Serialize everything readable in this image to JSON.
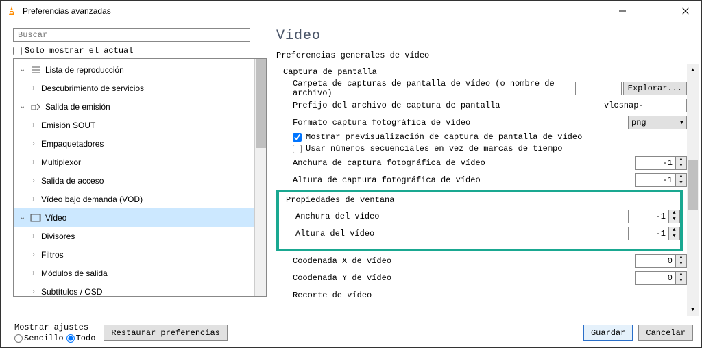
{
  "window": {
    "title": "Preferencias avanzadas"
  },
  "search": {
    "placeholder": "Buscar",
    "only_current_label": "Solo mostrar el actual"
  },
  "tree": {
    "items": [
      {
        "label": "Lista de reproducción",
        "level": 0,
        "expanded": true,
        "icon": "list"
      },
      {
        "label": "Descubrimiento de servicios",
        "level": 1
      },
      {
        "label": "Salida de emisión",
        "level": 0,
        "expanded": true,
        "icon": "stream"
      },
      {
        "label": "Emisión SOUT",
        "level": 1
      },
      {
        "label": "Empaquetadores",
        "level": 1
      },
      {
        "label": "Multiplexor",
        "level": 1
      },
      {
        "label": "Salida de acceso",
        "level": 1
      },
      {
        "label": "Vídeo bajo demanda (VOD)",
        "level": 1
      },
      {
        "label": "Vídeo",
        "level": 0,
        "expanded": true,
        "selected": true,
        "icon": "video"
      },
      {
        "label": "Divisores",
        "level": 1
      },
      {
        "label": "Filtros",
        "level": 1
      },
      {
        "label": "Módulos de salida",
        "level": 1
      },
      {
        "label": "Subtítulos / OSD",
        "level": 1
      }
    ]
  },
  "right": {
    "title": "Vídeo",
    "subtitle": "Preferencias generales de vídeo",
    "screenshot_group": "Captura de pantalla",
    "screenshot_folder_label": "Carpeta de capturas de pantalla de vídeo (o nombre de archivo)",
    "screenshot_folder_value": "",
    "browse_btn": "Explorar...",
    "prefix_label": "Prefijo del archivo de captura de pantalla",
    "prefix_value": "vlcsnap-",
    "format_label": "Formato captura fotográfica de vídeo",
    "format_value": "png",
    "show_preview_label": "Mostrar previsualización de captura de pantalla de vídeo",
    "use_seq_label": "Usar números secuenciales en vez de marcas de tiempo",
    "width_capture_label": "Anchura de captura fotográfica de vídeo",
    "width_capture_value": "-1",
    "height_capture_label": "Altura de captura fotográfica de vídeo",
    "height_capture_value": "-1",
    "window_group": "Propiedades de ventana",
    "video_width_label": "Anchura del vídeo",
    "video_width_value": "-1",
    "video_height_label": "Altura del vídeo",
    "video_height_value": "-1",
    "coord_x_label": "Coodenada X de vídeo",
    "coord_x_value": "0",
    "coord_y_label": "Coodenada Y de vídeo",
    "coord_y_value": "0",
    "crop_label": "Recorte de vídeo"
  },
  "bottom": {
    "show_settings_label": "Mostrar ajustes",
    "simple_label": "Sencillo",
    "all_label": "Todo",
    "reset_btn": "Restaurar preferencias",
    "save_btn": "Guardar",
    "cancel_btn": "Cancelar"
  }
}
